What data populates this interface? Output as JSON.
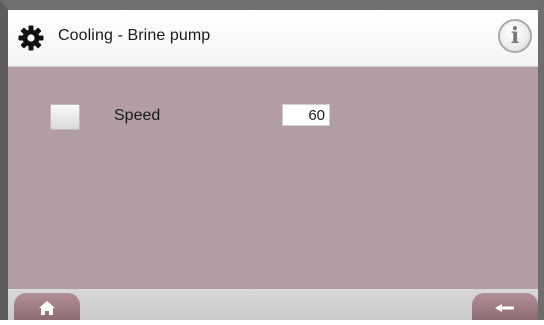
{
  "header": {
    "title": "Cooling - Brine pump",
    "settings_icon": "gear-icon",
    "info_icon": "info-icon",
    "info_glyph": "i"
  },
  "main": {
    "speed": {
      "label": "Speed",
      "value": "60",
      "enabled": false
    }
  },
  "footer": {
    "home_icon": "home-icon",
    "back_icon": "back-arrow-icon"
  },
  "colors": {
    "background": "#b39ca3",
    "header": "#ffffff",
    "button": "#9c7b83"
  }
}
